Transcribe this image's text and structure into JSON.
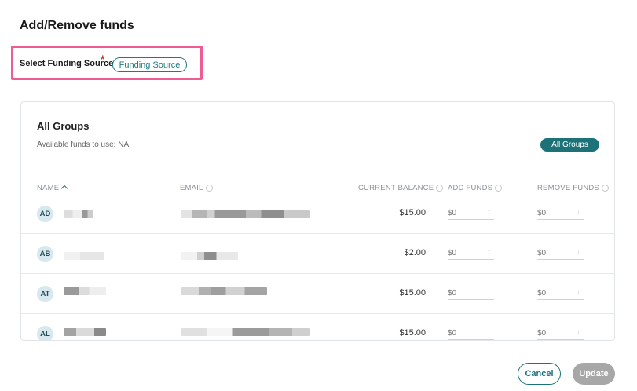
{
  "page": {
    "title": "Add/Remove funds"
  },
  "funding": {
    "label": "Select Funding Source",
    "required_mark": "*",
    "button_label": "Funding Source"
  },
  "card": {
    "title": "All Groups",
    "subtitle": "Available funds to use: NA",
    "group_button": "All Groups",
    "columns": {
      "name": "NAME",
      "email": "EMAIL",
      "balance": "CURRENT BALANCE",
      "add": "ADD FUNDS",
      "remove": "REMOVE FUNDS"
    },
    "rows": [
      {
        "initials": "AD",
        "balance": "$15.00",
        "add_placeholder": "$0",
        "remove_placeholder": "$0"
      },
      {
        "initials": "AB",
        "balance": "$2.00",
        "add_placeholder": "$0",
        "remove_placeholder": "$0"
      },
      {
        "initials": "AT",
        "balance": "$15.00",
        "add_placeholder": "$0",
        "remove_placeholder": "$0"
      },
      {
        "initials": "AL",
        "balance": "$15.00",
        "add_placeholder": "$0",
        "remove_placeholder": "$0"
      }
    ]
  },
  "footer": {
    "cancel": "Cancel",
    "update": "Update"
  },
  "icons": {
    "up_arrow": "↑",
    "down_arrow": "↓"
  },
  "colors": {
    "accent": "#1d7279",
    "highlight": "#ef5b93",
    "disabled": "#a7a7a7"
  }
}
